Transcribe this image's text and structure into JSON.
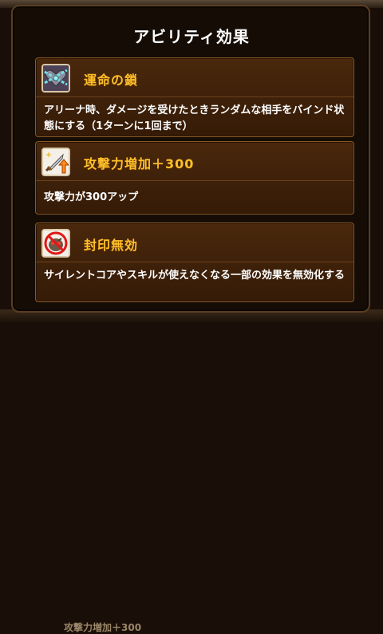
{
  "dialog": {
    "title": "アビリティ効果"
  },
  "background": {
    "bottom_text": "攻撃力増加＋300"
  },
  "abilities": [
    {
      "icon": "chain-heart-icon",
      "name": "運命の鎖",
      "description": "アリーナ時、ダメージを受けたときランダムな相手をバインド状態にする（1ターンに1回まで）"
    },
    {
      "icon": "sword-up-arrow-icon",
      "name": "攻撃力増加＋300",
      "description": "攻撃力が300アップ"
    },
    {
      "icon": "seal-prohibited-icon",
      "name": "封印無効",
      "description": "サイレントコアやスキルが使えなくなる一部の効果を無効化する"
    }
  ],
  "colors": {
    "ability_name": "#ffc02a",
    "card_background": "#3d2009",
    "card_border": "#8a5a26",
    "panel_background": "#150c06"
  }
}
